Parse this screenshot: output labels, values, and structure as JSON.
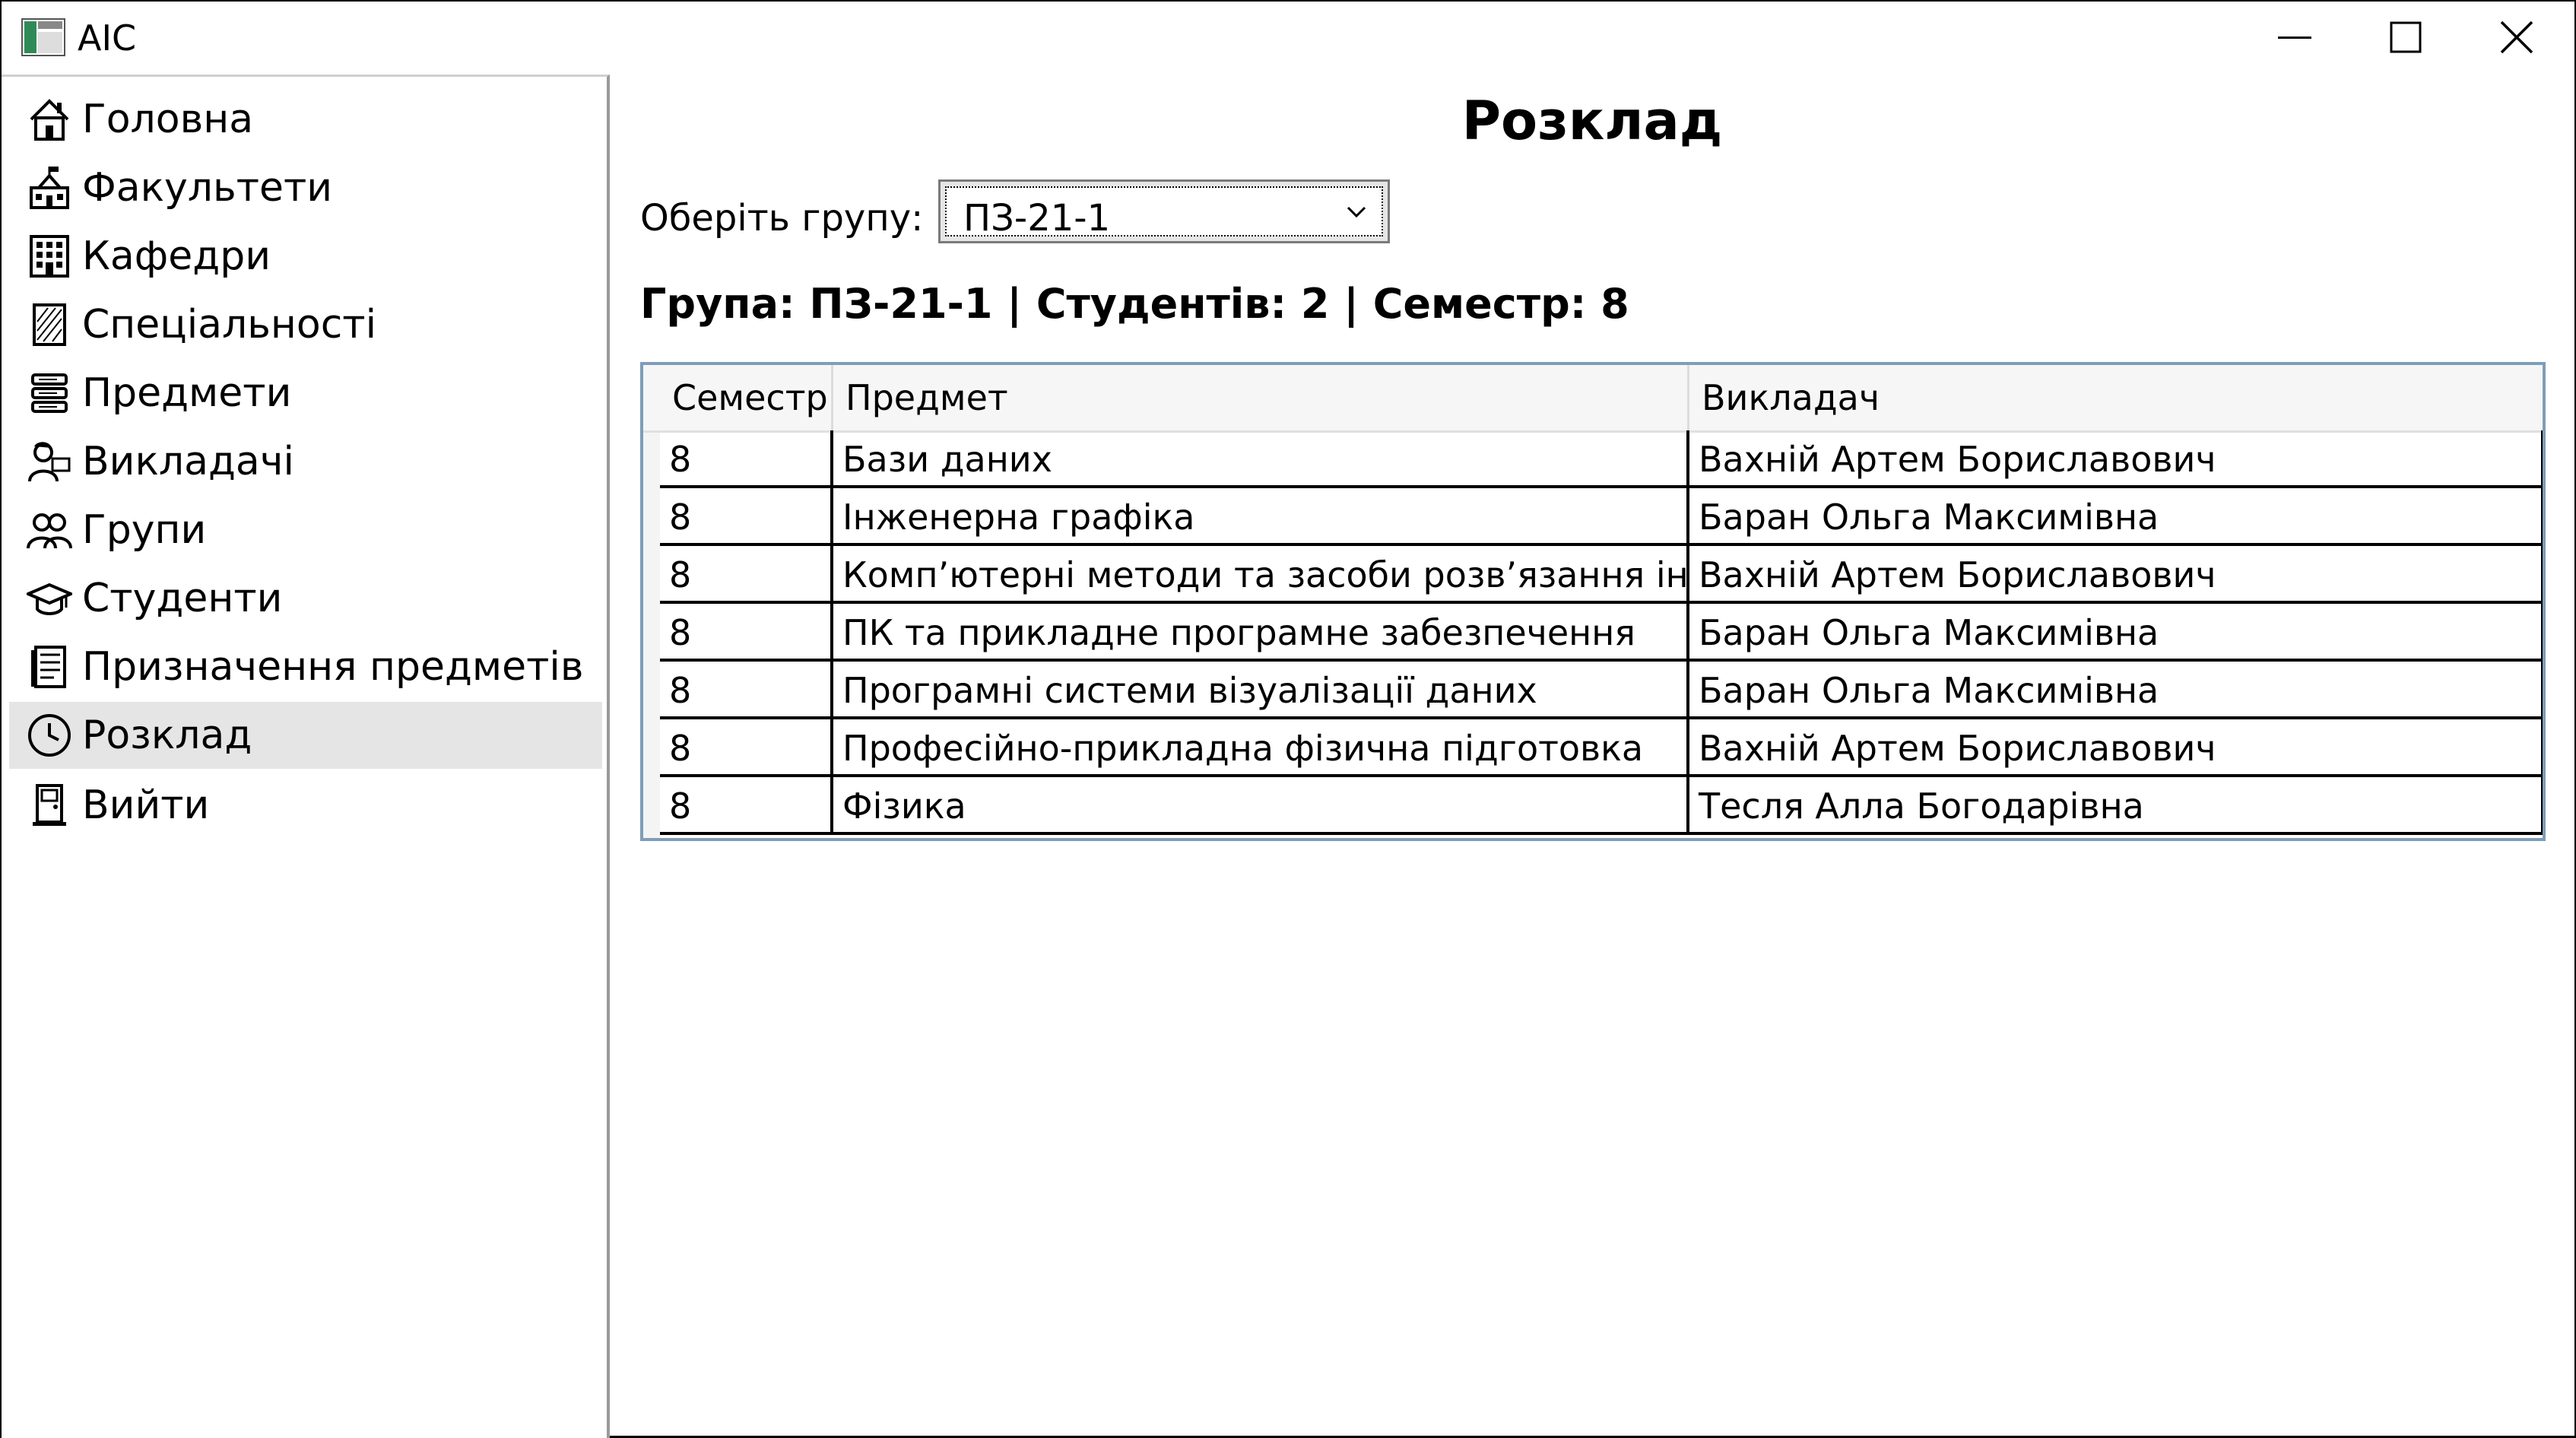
{
  "window": {
    "title": "AIC"
  },
  "sidebar": {
    "items": [
      {
        "label": "Головна",
        "icon": "home-icon",
        "selected": false
      },
      {
        "label": "Факультети",
        "icon": "school-building-icon",
        "selected": false
      },
      {
        "label": "Кафедри",
        "icon": "office-building-icon",
        "selected": false
      },
      {
        "label": "Спеціальності",
        "icon": "notebook-icon",
        "selected": false
      },
      {
        "label": "Предмети",
        "icon": "books-icon",
        "selected": false
      },
      {
        "label": "Викладачі",
        "icon": "teacher-icon",
        "selected": false
      },
      {
        "label": "Групи",
        "icon": "users-icon",
        "selected": false
      },
      {
        "label": "Студенти",
        "icon": "graduation-cap-icon",
        "selected": false
      },
      {
        "label": "Призначення предметів",
        "icon": "document-list-icon",
        "selected": false
      },
      {
        "label": "Розклад",
        "icon": "clock-icon",
        "selected": true
      },
      {
        "label": "Вийти",
        "icon": "exit-door-icon",
        "selected": false
      }
    ]
  },
  "main": {
    "title": "Розклад",
    "group_label": "Оберіть групу:",
    "group_select_value": "ПЗ-21-1",
    "info_line": "Група: ПЗ-21-1 | Студентів: 2 | Семестр: 8",
    "table": {
      "columns": [
        "Семестр",
        "Предмет",
        "Викладач"
      ],
      "rows": [
        [
          "8",
          "Бази даних",
          "Вахній Артем Бориславович"
        ],
        [
          "8",
          "Інженерна графіка",
          "Баран Ольга Максимівна"
        ],
        [
          "8",
          "Комп’ютерні методи та засоби розв’язання інжене",
          "Вахній Артем Бориславович"
        ],
        [
          "8",
          "ПК та прикладне програмне забезпечення",
          "Баран Ольга Максимівна"
        ],
        [
          "8",
          "Програмні системи візуалізації даних",
          "Баран Ольга Максимівна"
        ],
        [
          "8",
          "Професійно-прикладна фізична підготовка",
          "Вахній Артем Бориславович"
        ],
        [
          "8",
          "Фізика",
          "Тесля Алла Богодарівна"
        ]
      ]
    }
  },
  "colors": {
    "selected_item_bg": "#e5e5e5",
    "grid_border": "#7f9db9",
    "header_bg": "#f6f6f6"
  }
}
